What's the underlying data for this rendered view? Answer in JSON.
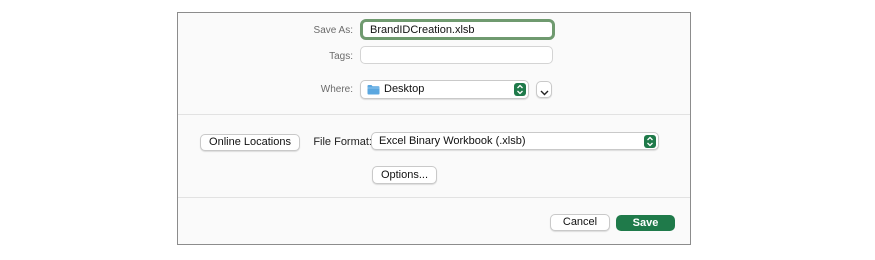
{
  "dialog": {
    "save_as": {
      "label": "Save As:",
      "value": "BrandIDCreation.xlsb"
    },
    "tags": {
      "label": "Tags:",
      "value": ""
    },
    "where": {
      "label": "Where:",
      "value": "Desktop",
      "icon": "folder-icon",
      "folder_color": "#5aa7e0"
    },
    "online_locations_label": "Online Locations",
    "file_format": {
      "label": "File Format:",
      "value": "Excel Binary Workbook (.xlsb)"
    },
    "options_label": "Options...",
    "cancel_label": "Cancel",
    "save_label": "Save",
    "accent_color": "#1f7a4a",
    "focus_ring_color": "#6f9a6f"
  }
}
